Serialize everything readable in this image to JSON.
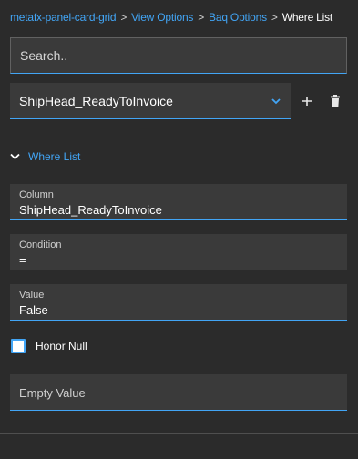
{
  "breadcrumb": {
    "items": [
      "metafx-panel-card-grid",
      "View Options",
      "Baq Options"
    ],
    "current": "Where List",
    "separator": ">"
  },
  "search": {
    "placeholder": "Search.."
  },
  "selector": {
    "value": "ShipHead_ReadyToInvoice",
    "add_icon": "plus-icon",
    "delete_icon": "trash-icon"
  },
  "section": {
    "title": "Where List",
    "expanded": true
  },
  "fields": {
    "column": {
      "label": "Column",
      "value": "ShipHead_ReadyToInvoice"
    },
    "condition": {
      "label": "Condition",
      "value": "="
    },
    "value": {
      "label": "Value",
      "value": "False"
    },
    "empty_value": {
      "placeholder": "Empty Value"
    }
  },
  "honor_null": {
    "label": "Honor Null",
    "checked": false
  },
  "colors": {
    "accent": "#42a5f5",
    "background": "#2b2b2b",
    "field_bg": "#3a3a3a"
  }
}
